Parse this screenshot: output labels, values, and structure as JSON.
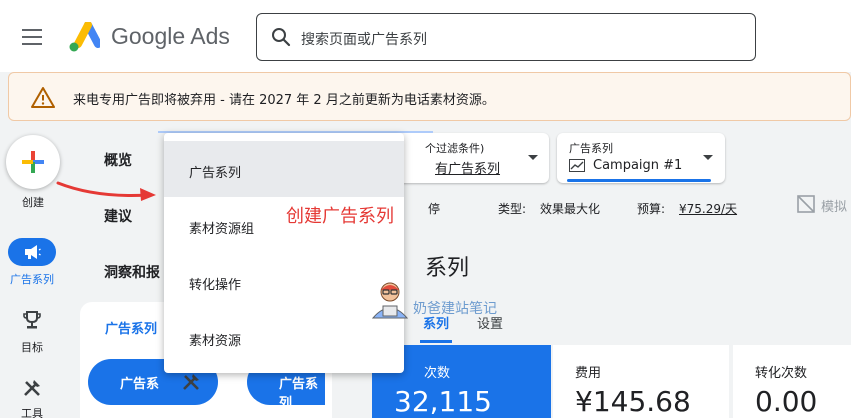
{
  "header": {
    "brand": "Google Ads",
    "search_placeholder": "搜索页面或广告系列"
  },
  "banner": {
    "text": "来电专用广告即将被弃用 - 请在 2027 年 2 月之前更新为电话素材资源。"
  },
  "rail": {
    "create_label": "创建",
    "campaigns_label": "广告系列",
    "goals_label": "目标",
    "tools_label": "工具"
  },
  "nav": {
    "overview": "概览",
    "recommendations": "建议",
    "insights": "洞察和报",
    "panel_title": "广告系列",
    "pill_left": "广告系",
    "pill_right": "广告系列"
  },
  "filters": {
    "filter_small": "个过滤条件)",
    "filter_big": "有广告系列",
    "campaign_small": "广告系列",
    "campaign_big": "Campaign #1"
  },
  "status_row": {
    "paused": "停",
    "type_label": "类型:",
    "type_value": "效果最大化",
    "budget_label": "预算:",
    "budget_value": "¥75.29/天",
    "simulate": "模拟"
  },
  "main": {
    "title_fragment": "系列",
    "tab_campaigns": "系列",
    "tab_settings": "设置"
  },
  "metrics": [
    {
      "label": "次数",
      "value": "32,115"
    },
    {
      "label": "费用",
      "value": "¥145.68"
    },
    {
      "label": "转化次数",
      "value": "0.00"
    }
  ],
  "dropdown": {
    "items": [
      "广告系列",
      "素材资源组",
      "转化操作",
      "素材资源"
    ]
  },
  "annotation": "创建广告系列",
  "watermark": "奶爸建站笔记",
  "colors": {
    "primary": "#1a73e8",
    "annotation": "#e53935",
    "banner_bg": "#fdf6ee",
    "warning": "#b06000"
  }
}
